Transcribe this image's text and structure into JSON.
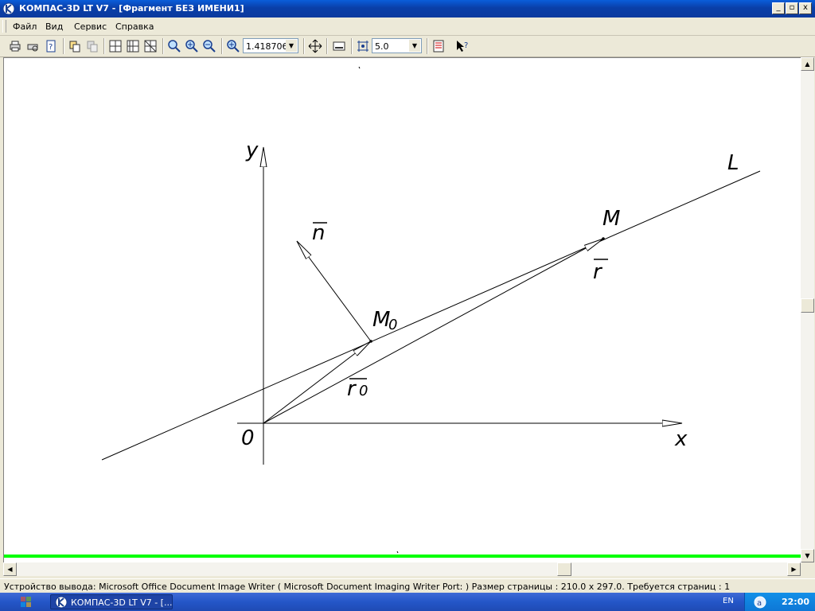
{
  "window": {
    "title": "КОМПАС-3D LT V7 - [Фрагмент БЕЗ ИМЕНИ1]",
    "minimize": "_",
    "maximize": "▫",
    "close": "x"
  },
  "menu": {
    "items": [
      "Файл",
      "Вид",
      "Сервис",
      "Справка"
    ]
  },
  "toolbar": {
    "zoom_value": "1.418706",
    "step_value": "5.0"
  },
  "drawing": {
    "labels": {
      "y_axis": "y",
      "x_axis": "x",
      "origin": "0",
      "line_name": "L",
      "point_m": "M",
      "point_m0": "M",
      "point_m0_sub": "0",
      "vector_n": "n",
      "vector_r": "r",
      "vector_r0": "r",
      "vector_r0_sub": "0"
    },
    "accent_color": "#00ff00"
  },
  "statusbar": {
    "text": "Устройство вывода: Microsoft Office Document Image Writer ( Microsoft Document Imaging Writer Port: )  Размер страницы : 210.0 x 297.0.  Требуется страниц : 1"
  },
  "taskbar": {
    "task_label": "КОМПАС-3D LT V7 - [...",
    "language": "EN",
    "clock": "22:00"
  }
}
